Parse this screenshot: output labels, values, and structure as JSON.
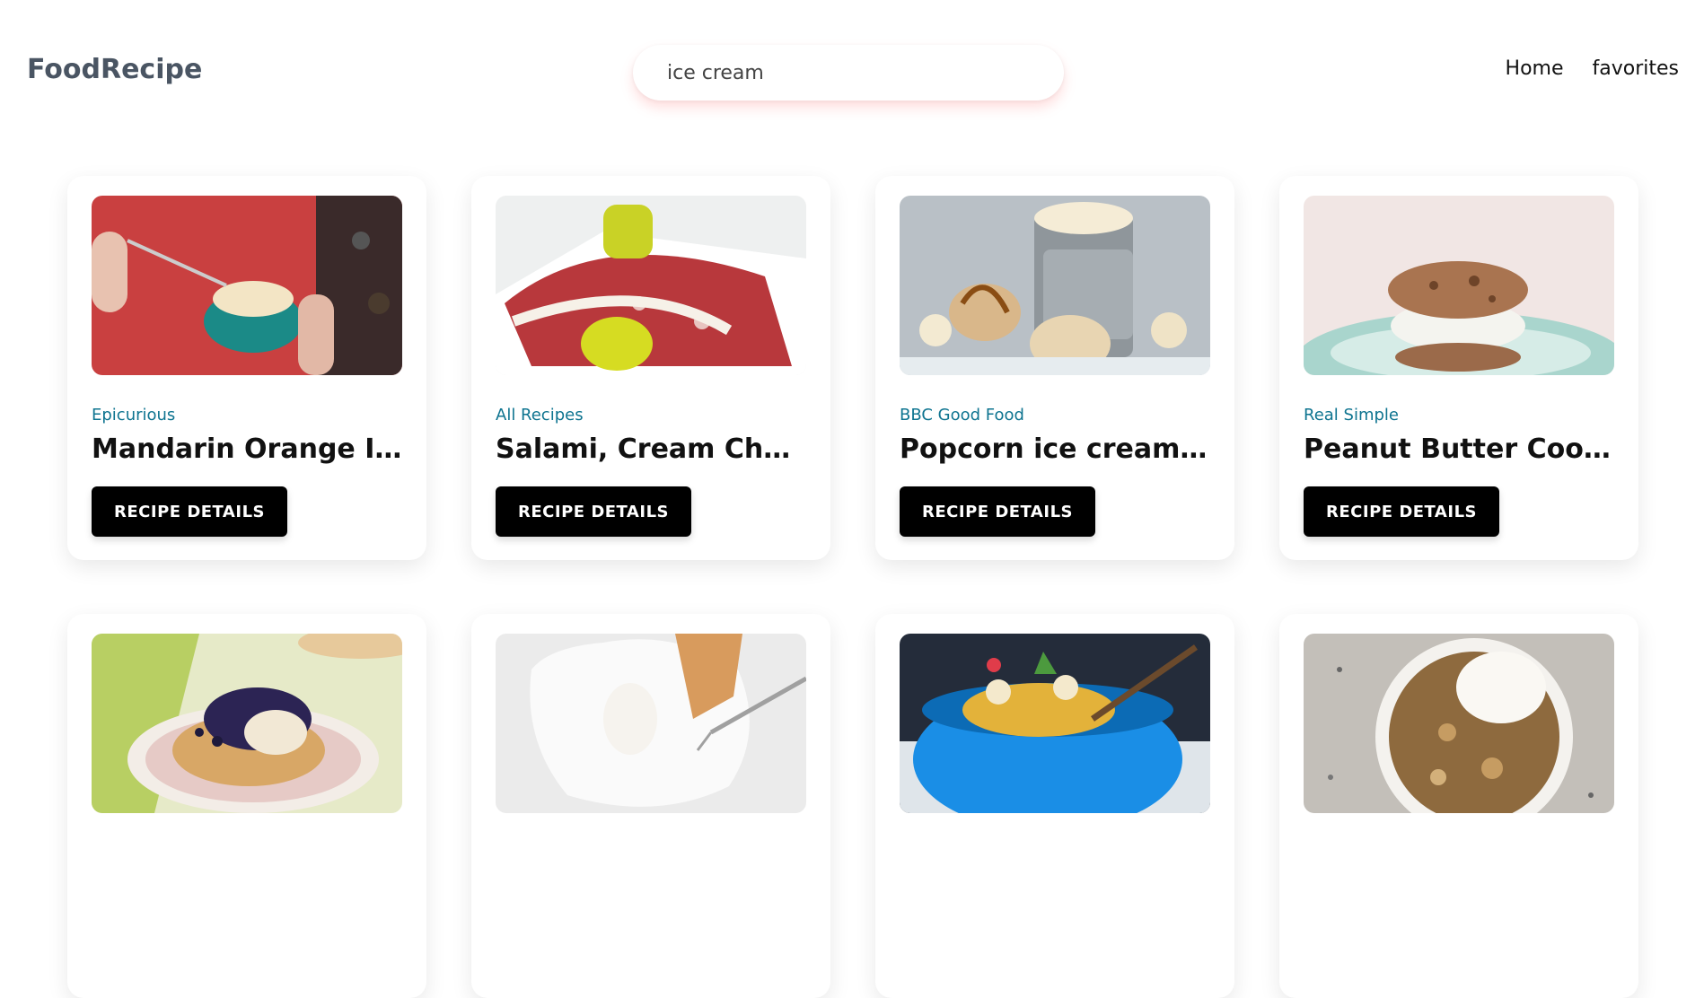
{
  "header": {
    "logo": "FoodRecipe",
    "search_value": "ice cream",
    "nav": [
      "Home",
      "favorites"
    ]
  },
  "colors": {
    "source_text": "#0e7490",
    "button_bg": "#000000",
    "logo": "#4a5563"
  },
  "recipes": [
    {
      "source": "Epicurious",
      "title": "Mandarin Orange Ice ...",
      "button": "RECIPE DETAILS",
      "image": "ice-cream-bowl-photo"
    },
    {
      "source": "All Recipes",
      "title": "Salami, Cream Cheese,...",
      "button": "RECIPE DETAILS",
      "image": "salami-roll-photo"
    },
    {
      "source": "BBC Good Food",
      "title": "Popcorn ice cream wit...",
      "button": "RECIPE DETAILS",
      "image": "popcorn-ice-cream-photo"
    },
    {
      "source": "Real Simple",
      "title": "Peanut Butter Cookie I...",
      "button": "RECIPE DETAILS",
      "image": "cookie-sandwich-photo"
    },
    {
      "image": "berry-tart-photo"
    },
    {
      "image": "pie-slice-photo"
    },
    {
      "image": "fruit-bowl-photo"
    },
    {
      "image": "apple-crumble-photo"
    }
  ]
}
